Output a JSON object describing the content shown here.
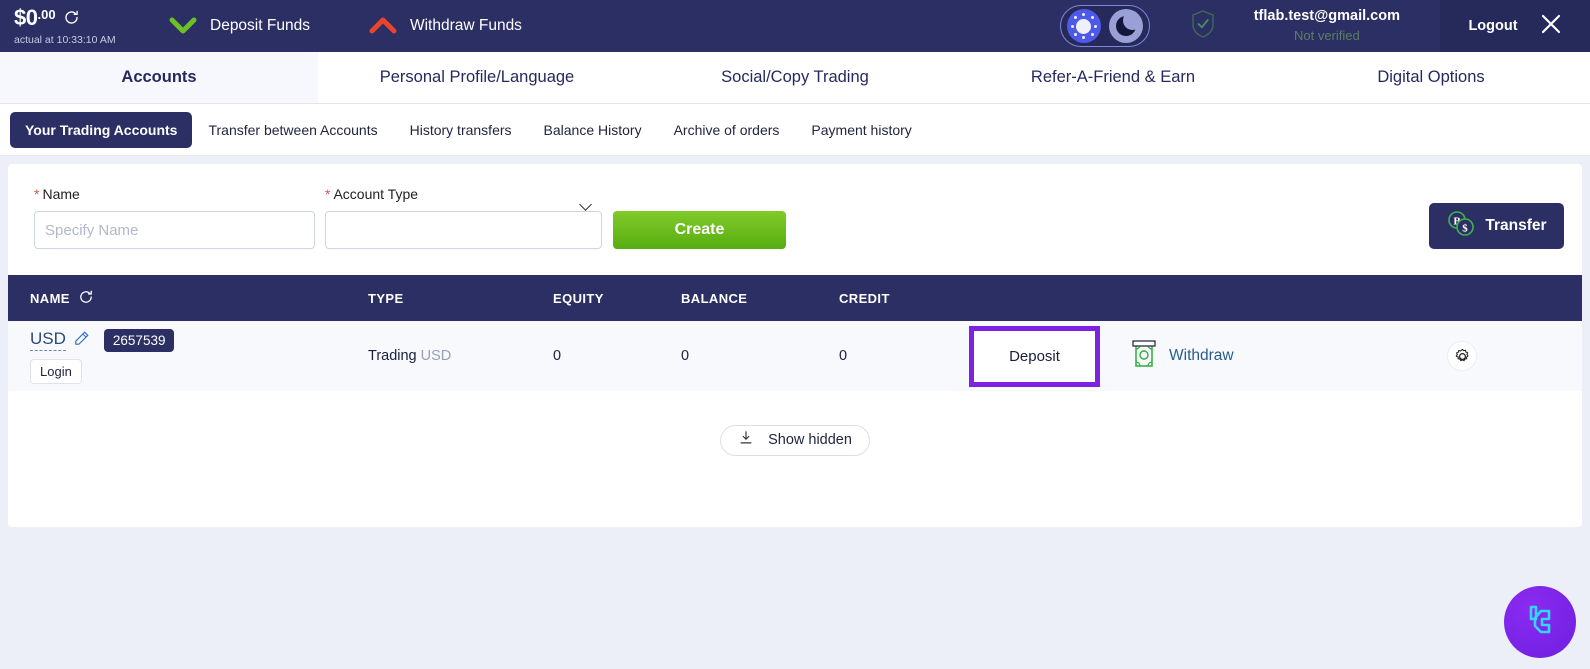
{
  "header": {
    "balance_main": "$0",
    "balance_cents": ".00",
    "balance_sub": "actual at 10:33:10 AM",
    "refresh_icon": "refresh-icon",
    "deposit_funds_label": "Deposit Funds",
    "withdraw_funds_label": "Withdraw Funds",
    "deposit_icon": "chevron-down-green-icon",
    "withdraw_icon": "chevron-up-red-icon",
    "theme_toggle": {
      "light_icon": "sun-icon",
      "dark_icon": "moon-icon",
      "selected": "light"
    },
    "verified_shield_icon": "shield-check-icon",
    "email": "tflab.test@gmail.com",
    "verification_status": "Not verified",
    "logout_label": "Logout",
    "close_icon": "close-icon",
    "colors": {
      "topbar_bg": "#2b2f63",
      "logout_bg": "#262a5a",
      "deposit_green": "#6cc027",
      "withdraw_red": "#e8452c"
    }
  },
  "main_nav": {
    "items": [
      {
        "label": "Accounts",
        "active": true
      },
      {
        "label": "Personal Profile/Language",
        "active": false
      },
      {
        "label": "Social/Copy Trading",
        "active": false
      },
      {
        "label": "Refer-A-Friend & Earn",
        "active": false
      },
      {
        "label": "Digital Options",
        "active": false
      }
    ]
  },
  "sub_nav": {
    "items": [
      {
        "label": "Your Trading Accounts",
        "active": true
      },
      {
        "label": "Transfer between Accounts",
        "active": false
      },
      {
        "label": "History transfers",
        "active": false
      },
      {
        "label": "Balance History",
        "active": false
      },
      {
        "label": "Archive of orders",
        "active": false
      },
      {
        "label": "Payment history",
        "active": false
      }
    ]
  },
  "create_form": {
    "name_label": "Name",
    "name_required_marker": "*",
    "name_value": "",
    "name_placeholder": "Specify Name",
    "account_type_label": "Account Type",
    "account_type_required_marker": "*",
    "account_type_value": "",
    "account_type_caret_icon": "chevron-down-icon",
    "create_label": "Create",
    "create_color": "#57ad10"
  },
  "transfer_button": {
    "label": "Transfer",
    "icon": "bitcoin-dollar-coins-icon"
  },
  "table": {
    "refresh_icon": "refresh-icon",
    "columns": [
      "NAME",
      "TYPE",
      "EQUITY",
      "BALANCE",
      "CREDIT"
    ],
    "rows": [
      {
        "name": "USD",
        "edit_icon": "edit-pencil-icon",
        "account_number": "2657539",
        "login_label": "Login",
        "type": "Trading",
        "type_currency": "USD",
        "equity": "0",
        "balance": "0",
        "credit": "0",
        "deposit_label": "Deposit",
        "deposit_highlighted": true,
        "highlight_color": "#7c22e0",
        "withdraw_label": "Withdraw",
        "withdraw_icon": "banknote-icon",
        "settings_icon": "gear-icon"
      }
    ]
  },
  "show_hidden": {
    "label": "Show hidden",
    "icon": "download-tray-icon"
  },
  "chat_widget": {
    "icon": "chat-logo-icon",
    "color": "#7c22e0"
  }
}
